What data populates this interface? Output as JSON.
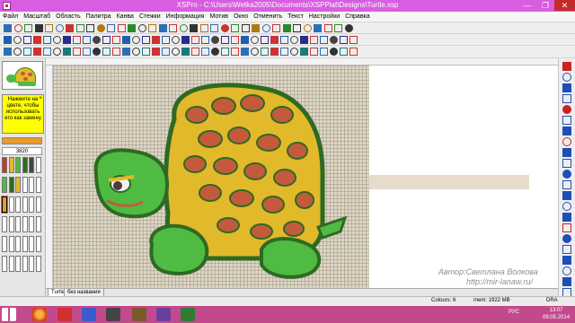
{
  "window": {
    "title": "XSPro - C:\\Users\\Wetka2005\\Documents\\XSPPlat\\Designs\\Turtle.xsp",
    "min_glyph": "—",
    "max_glyph": "❐",
    "close_glyph": "✕"
  },
  "menu": [
    "Файл",
    "Масштаб",
    "Область",
    "Палитра",
    "Канва",
    "Стежки",
    "Информация",
    "Мотив",
    "Окно",
    "Отменить",
    "Текст",
    "Настройки",
    "Справка"
  ],
  "left_panel": {
    "notice": "Нажмите на цвете, чтобы использовать его как замену",
    "notice_close": "×",
    "color_code": "3820",
    "selected_color": "#e79a2d"
  },
  "canvas": {
    "fabric_color": "#ddd5c5",
    "watermark_author": "Автор:Светлана Волкова",
    "watermark_url": "http://mir-lanaw.ru/"
  },
  "tabs": [
    "Turtle",
    "без названия"
  ],
  "status": {
    "colours": "Colours: 6",
    "memory": "mem: 1922 MB",
    "mode": "DRA"
  },
  "taskbar": {
    "language": "РУС",
    "time": "13:07",
    "date": "09.05.2014"
  },
  "colors": {
    "titlebar": "#d95de1",
    "taskbar": "#c24a8c",
    "turtle_green": "#4fbb43",
    "turtle_shell_yellow": "#e2b92b",
    "turtle_shell_red": "#c45a3c",
    "turtle_outline": "#2e6a22"
  }
}
